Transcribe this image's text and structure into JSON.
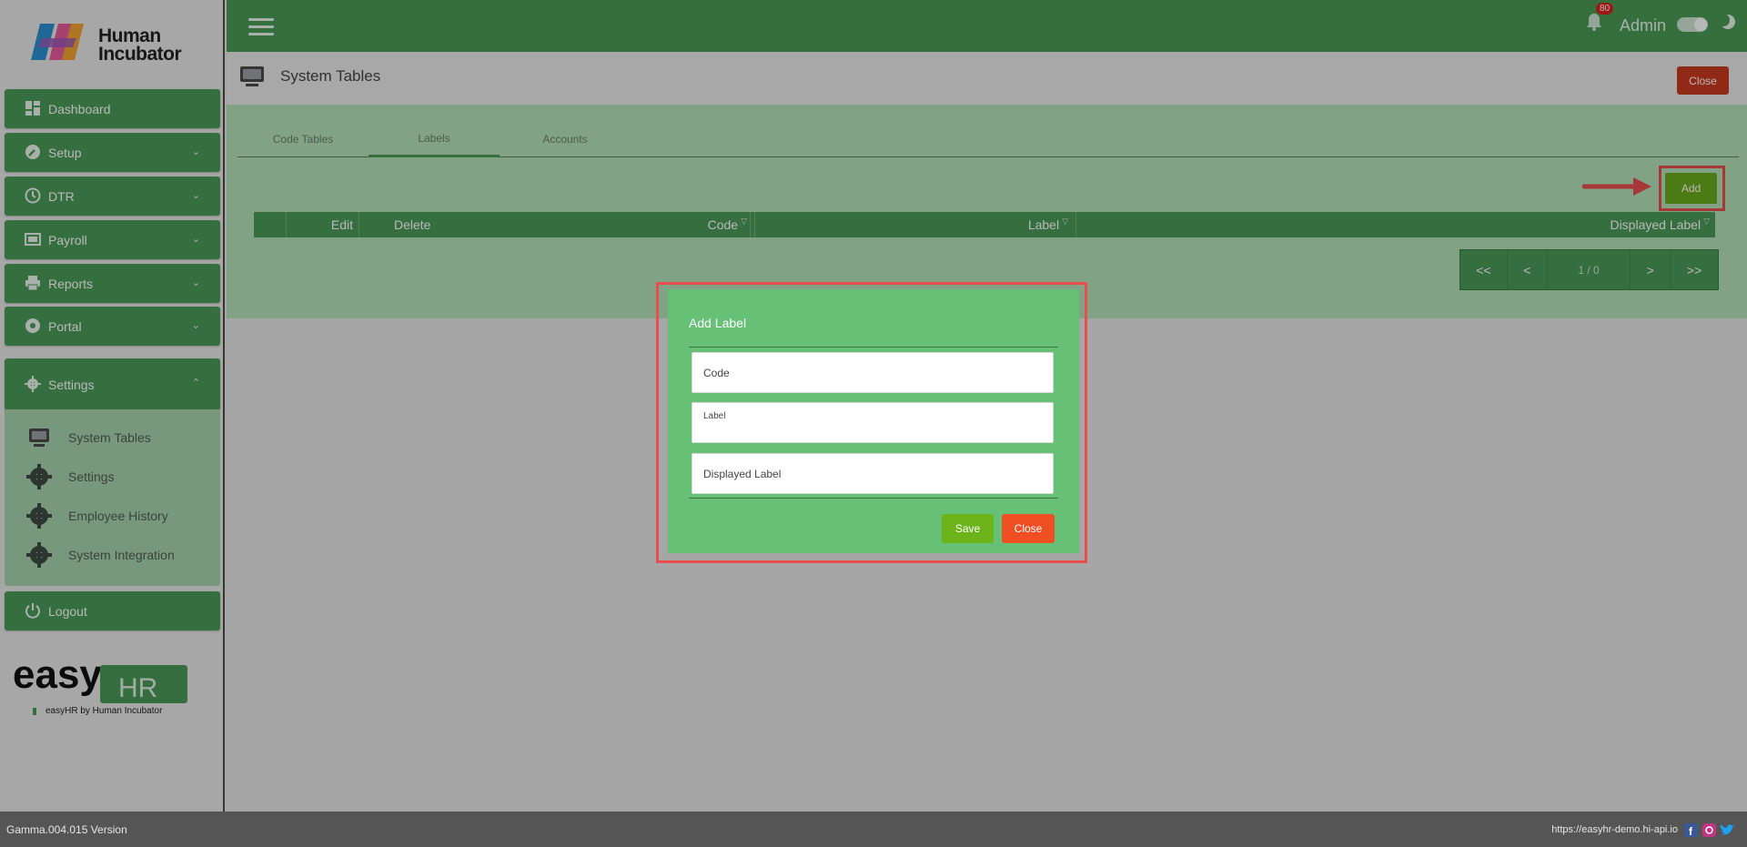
{
  "brand": {
    "logo_text_line1": "Human",
    "logo_text_line2": "Incubator",
    "product_by": "easyHR by Human Incubator"
  },
  "sidebar": {
    "items": [
      {
        "label": "Dashboard",
        "icon": "dashboard-icon"
      },
      {
        "label": "Setup",
        "icon": "wrench-icon"
      },
      {
        "label": "DTR",
        "icon": "clock-icon"
      },
      {
        "label": "Payroll",
        "icon": "payroll-icon"
      },
      {
        "label": "Reports",
        "icon": "printer-icon"
      },
      {
        "label": "Portal",
        "icon": "aperture-icon"
      },
      {
        "label": "Settings",
        "icon": "gear-icon"
      },
      {
        "label": "Logout",
        "icon": "power-icon"
      }
    ],
    "settings_submenu": [
      "System Tables",
      "Settings",
      "Employee History",
      "System Integration"
    ]
  },
  "topbar": {
    "notifications": "80",
    "user": "Admin"
  },
  "page": {
    "title": "System Tables",
    "close_label": "Close"
  },
  "tabs": [
    "Code Tables",
    "Labels",
    "Accounts"
  ],
  "toolbar": {
    "add_label": "Add"
  },
  "grid": {
    "columns": [
      "Edit",
      "Delete",
      "Code",
      "Label",
      "Displayed Label"
    ]
  },
  "pager": {
    "first": "<<",
    "prev": "<",
    "status": "1 / 0",
    "next": ">",
    "last": ">>"
  },
  "modal": {
    "title": "Add Label",
    "fields": {
      "code": "Code",
      "label": "Label",
      "displayed_label": "Displayed Label"
    },
    "save_label": "Save",
    "close_label": "Close"
  },
  "footer": {
    "version": "Gamma.004.015 Version",
    "url": "https://easyhr-demo.hi-api.io"
  },
  "colors": {
    "primary": "#4c9a58",
    "danger": "#c93a20",
    "add": "#6aaa1c",
    "highlight": "#e94d4d"
  }
}
